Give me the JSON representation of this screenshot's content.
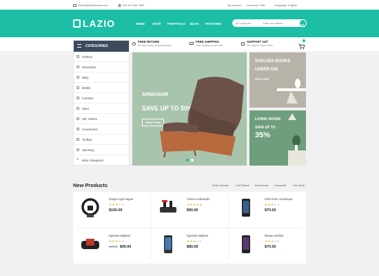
{
  "topbar": {
    "email": "Demo@Worthemes.com",
    "phone": "+84 123 456 7899",
    "account": "My Account",
    "currency": "Currency: USD",
    "language": "Language: English"
  },
  "header": {
    "logo": "LAZIO",
    "nav": [
      "HOME",
      "SHOP",
      "PORTFOLIO",
      "BLOG",
      "FEATURES"
    ],
    "search_category": "All Categories",
    "search_placeholder": "Enter your search"
  },
  "infobar": [
    {
      "title": "FREE RETURN",
      "sub": "30 days money back guarantee"
    },
    {
      "title": "FREE SHIPPING",
      "sub": "Free shipping on all order"
    },
    {
      "title": "SUPPORT 24/7",
      "sub": "We support online 24hrs"
    }
  ],
  "categories": {
    "title": "CATEGORIES",
    "items": [
      "Fashion",
      "Electronics",
      "Baby",
      "Mobile",
      "Furniture",
      "Sport",
      "Gift, Parties",
      "Accessories",
      "Toolbox",
      "Samsung",
      "More Categories"
    ]
  },
  "slider": {
    "heading": "ARMCHAIR",
    "offer": "SAVE UP TO 50% OFF",
    "button": "SHOP NOW"
  },
  "banner1": {
    "title": "SHELVES BOOKS",
    "sub": "UNDER $35",
    "button": "SHOP NOW"
  },
  "banner2": {
    "title": "LIVING ROOM",
    "sub": "SAVE UP TO",
    "value": "35%"
  },
  "products_section": {
    "title": "New Products",
    "tabs": [
      "Video Games",
      "Cell Phone",
      "Electronics",
      "Computer",
      "See More"
    ]
  },
  "products": [
    {
      "name": "Integer eget augue",
      "price": "$100.00",
      "old_price": "",
      "icon": "steering-wheel-icon"
    },
    {
      "name": "Viverra sollicitudin",
      "price": "$90.00",
      "old_price": "",
      "icon": "flight-throttle-icon"
    },
    {
      "name": "Odio tortor consequat",
      "price": "$70.00",
      "old_price": "",
      "icon": "smartphone-icon"
    },
    {
      "name": "Egestas dapibus",
      "price": "$40.00",
      "old_price": "$50.00",
      "icon": "gamepad-phone-icon"
    },
    {
      "name": "Egestas dapibus",
      "price": "$80.00",
      "old_price": "",
      "icon": "smartphone-icon"
    },
    {
      "name": "Neque porttitor",
      "price": "$70.00",
      "old_price": "",
      "icon": "smartphone-icon"
    }
  ],
  "colors": {
    "accent": "#1cbfa5",
    "category_header": "#3d4a5c",
    "star": "#f5a623"
  }
}
